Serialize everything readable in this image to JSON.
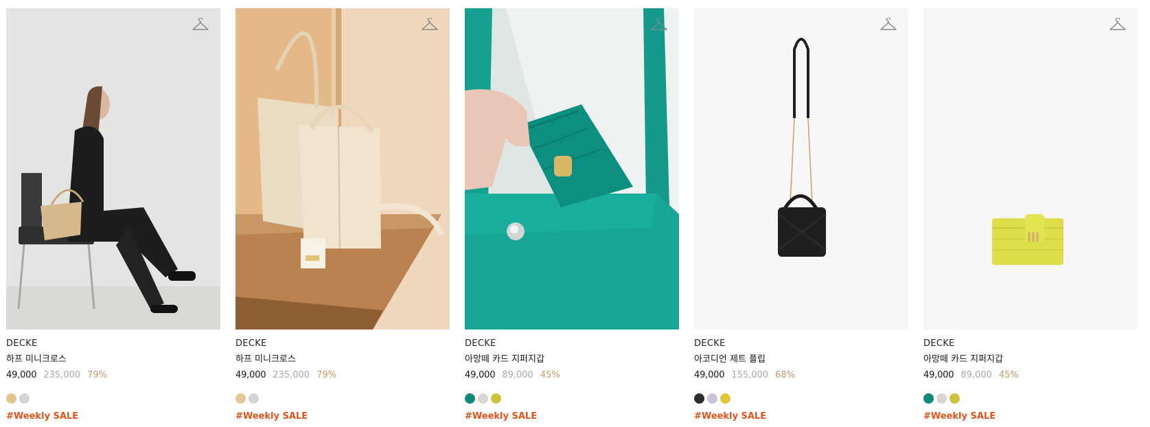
{
  "products": [
    {
      "brand": "DECKE",
      "name": "하프 미니크로스",
      "price": "49,000",
      "original_price": "235,000",
      "discount": "79%",
      "swatches": [
        "#e6c391",
        "#d4d4d4"
      ],
      "tag": "#Weekly SALE",
      "image": "model-with-beige-bag"
    },
    {
      "brand": "DECKE",
      "name": "하프 미니크로스",
      "price": "49,000",
      "original_price": "235,000",
      "discount": "79%",
      "swatches": [
        "#e3c697",
        "#d4d4d4"
      ],
      "tag": "#Weekly SALE",
      "image": "beige-bucket-bag-on-table"
    },
    {
      "brand": "DECKE",
      "name": "아망떼 카드 지퍼지갑",
      "price": "49,000",
      "original_price": "89,000",
      "discount": "45%",
      "swatches": [
        "#0f8a7a",
        "#d9d6d1",
        "#d1c13a"
      ],
      "tag": "#Weekly SALE",
      "image": "teal-card-wallet-closeup"
    },
    {
      "brand": "DECKE",
      "name": "아코디언 제트 플립",
      "price": "49,000",
      "original_price": "155,000",
      "discount": "68%",
      "swatches": [
        "#2e2e2e",
        "#cbc3dc",
        "#e3c53a"
      ],
      "tag": "#Weekly SALE",
      "image": "black-mini-bag-chain-strap"
    },
    {
      "brand": "DECKE",
      "name": "아망떼 카드 지퍼지갑",
      "price": "49,000",
      "original_price": "89,000",
      "discount": "45%",
      "swatches": [
        "#0f8a7a",
        "#d9d6d1",
        "#d1c13a"
      ],
      "tag": "#Weekly SALE",
      "image": "yellow-card-wallet"
    }
  ],
  "icons": {
    "wishlist": "hanger-icon"
  },
  "colors": {
    "sale_tag": "#e2541c",
    "discount": "#c79a6a",
    "original_price": "#a8a8a8"
  }
}
